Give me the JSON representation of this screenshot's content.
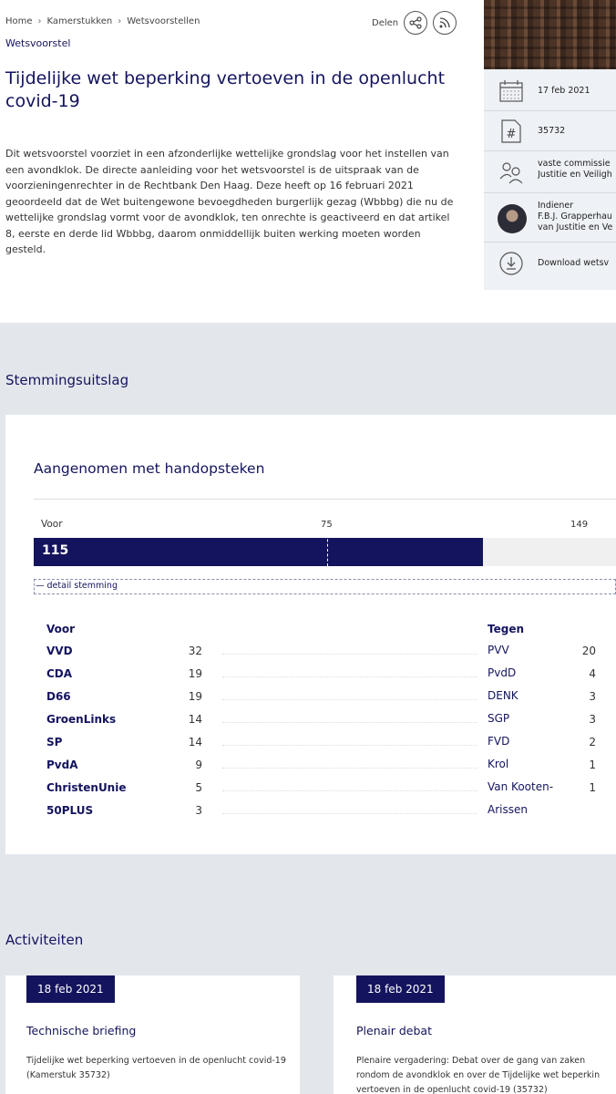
{
  "breadcrumb": [
    "Home",
    "Kamerstukken",
    "Wetsvoorstellen"
  ],
  "share_label": "Delen",
  "type_label": "Wetsvoorstel",
  "title": "Tijdelijke wet beperking vertoeven in de openlucht covid-19",
  "description": "Dit wetsvoorstel voorziet in een afzonderlijke wettelijke grondslag voor het instellen van een avondklok. De directe aanleiding voor het wetsvoorstel is de uitspraak van de voorzieningenrechter in de Rechtbank Den Haag. Deze heeft op 16 februari 2021 geoordeeld dat de Wet buitengewone bevoegdheden burgerlijk gezag (Wbbbg) die nu de wettelijke grondslag vormt voor de avondklok, ten onrechte is geactiveerd en dat artikel 8, eerste en derde lid Wbbbg, daarom onmiddellijk buiten werking moeten worden gesteld.",
  "sidebar": {
    "date": "17 feb 2021",
    "number": "35732",
    "committee_line1": "vaste commissie",
    "committee_line2": "Justitie en Veiligh",
    "submitter_label": "Indiener",
    "submitter_line1": "F.B.J. Grapperhau",
    "submitter_line2": "van Justitie en Ve",
    "download_label": "Download wetsv"
  },
  "vote_section_title": "Stemmingsuitslag",
  "vote": {
    "result_title": "Aangenomen met handopsteken",
    "bar_label": "Voor",
    "majority_label": "75",
    "total_label": "149",
    "voor_total": "115",
    "voor_fraction": 0.7718,
    "majority_fraction": 0.5034,
    "detail_label": "detail stemming",
    "voor_heading": "Voor",
    "tegen_heading": "Tegen",
    "voor": [
      {
        "party": "VVD",
        "seats": "32"
      },
      {
        "party": "CDA",
        "seats": "19"
      },
      {
        "party": "D66",
        "seats": "19"
      },
      {
        "party": "GroenLinks",
        "seats": "14"
      },
      {
        "party": "SP",
        "seats": "14"
      },
      {
        "party": "PvdA",
        "seats": "9"
      },
      {
        "party": "ChristenUnie",
        "seats": "5"
      },
      {
        "party": "50PLUS",
        "seats": "3"
      }
    ],
    "tegen": [
      {
        "party": "PVV",
        "seats": "20"
      },
      {
        "party": "PvdD",
        "seats": "4"
      },
      {
        "party": "DENK",
        "seats": "3"
      },
      {
        "party": "SGP",
        "seats": "3"
      },
      {
        "party": "FVD",
        "seats": "2"
      },
      {
        "party": "Krol",
        "seats": "1"
      },
      {
        "party": "Van Kooten-Arissen",
        "seats": "1"
      }
    ]
  },
  "activities_title": "Activiteiten",
  "activities": [
    {
      "date": "18 feb 2021",
      "title": "Technische briefing",
      "desc": "Tijdelijke wet beperking vertoeven in de openlucht covid-19 (Kamerstuk 35732)"
    },
    {
      "date": "18 feb 2021",
      "title": "Plenair debat",
      "desc": "Plenaire vergadering: Debat over de gang van zaken rondom de avondklok en over de Tijdelijke wet beperkin vertoeven in de openlucht covid-19 (35732)"
    }
  ],
  "colors": {
    "navy": "#14145e",
    "band": "#e3e7ec",
    "sidebar": "#eef1f5"
  },
  "icons": [
    "share-icon",
    "rss-icon",
    "calendar-icon",
    "hash-icon",
    "people-icon",
    "download-icon"
  ]
}
